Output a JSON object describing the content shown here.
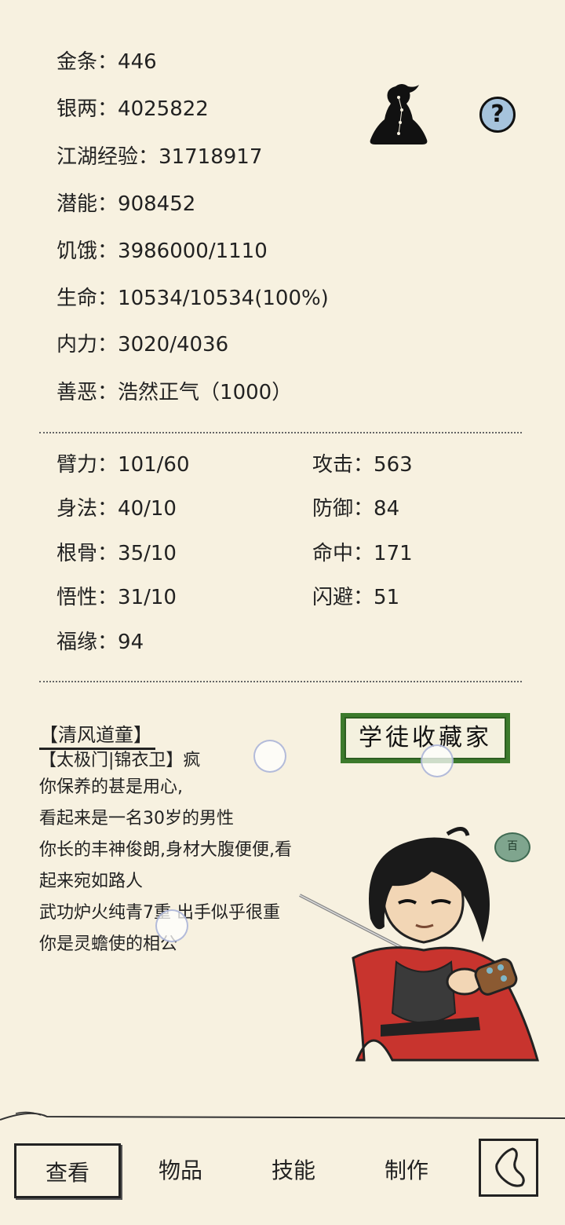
{
  "stats_top": [
    {
      "label": "金条",
      "sep": "：",
      "value": "446"
    },
    {
      "label": "银两",
      "sep": "：",
      "value": "4025822"
    },
    {
      "label": "江湖经验",
      "sep": "：",
      "value": "31718917"
    },
    {
      "label": "潜能",
      "sep": "：",
      "value": "908452"
    },
    {
      "label": "饥饿",
      "sep": "：",
      "value": "3986000/1110"
    },
    {
      "label": "生命",
      "sep": "：",
      "value": "10534/10534(100%)"
    },
    {
      "label": "内力",
      "sep": "：",
      "value": "3020/4036"
    },
    {
      "label": "善恶",
      "sep": "：",
      "value": "浩然正气（1000）"
    }
  ],
  "attributes_left": [
    {
      "label": "臂力",
      "sep": "：",
      "value": "101/60"
    },
    {
      "label": "身法",
      "sep": "：",
      "value": "40/10"
    },
    {
      "label": "根骨",
      "sep": "：",
      "value": "35/10"
    },
    {
      "label": "悟性",
      "sep": "：",
      "value": "31/10"
    },
    {
      "label": "福缘",
      "sep": "：",
      "value": "94"
    }
  ],
  "attributes_right": [
    {
      "label": "攻击",
      "sep": "：",
      "value": "563"
    },
    {
      "label": "防御",
      "sep": "：",
      "value": "84"
    },
    {
      "label": "命中",
      "sep": "：",
      "value": "171"
    },
    {
      "label": "闪避",
      "sep": "：",
      "value": "51"
    }
  ],
  "profile": {
    "title": "【清风道童】",
    "lines": [
      "【太极门|锦衣卫】疯",
      "你保养的甚是用心,",
      "看起来是一名30岁的男性",
      "你长的丰神俊朗,身材大腹便便,看",
      "起来宛如路人",
      "武功炉火纯青7重 出手似乎很重",
      "你是灵蟾使的相公"
    ],
    "badge": "学徒收藏家",
    "jade_badge": "百"
  },
  "help_icon": "?",
  "nav": {
    "view": "查看",
    "items": "物品",
    "skills": "技能",
    "craft": "制作"
  },
  "colors": {
    "background": "#f7f1e0",
    "badge_green": "#3c7a2c",
    "help_blue": "#a6c3dc",
    "robe_red": "#c8342e"
  }
}
